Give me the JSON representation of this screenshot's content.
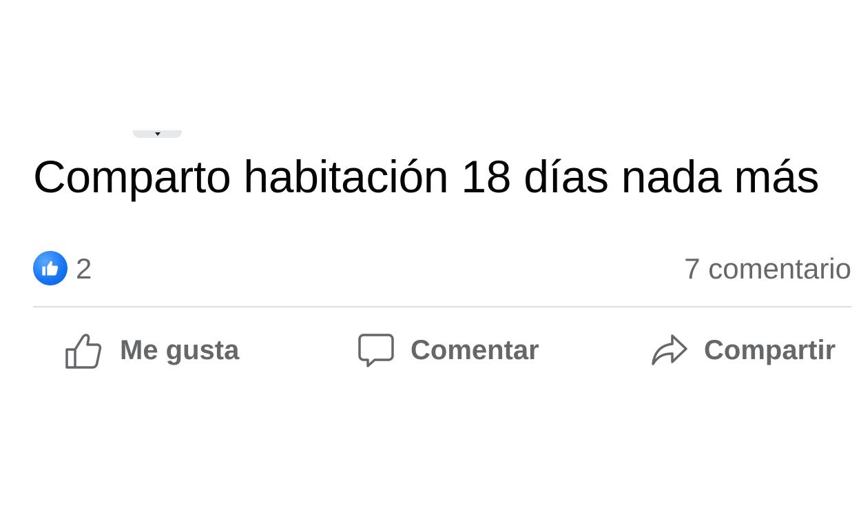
{
  "post": {
    "text": "Comparto habitación 18 días nada más"
  },
  "stats": {
    "reaction_icon": "like-reaction-icon",
    "reaction_count": "2",
    "comment_count": "7 comentario"
  },
  "actions": {
    "like_label": "Me gusta",
    "comment_label": "Comentar",
    "share_label": "Compartir"
  },
  "colors": {
    "brand_blue": "#1877f2",
    "secondary_text": "#65676b",
    "primary_text": "#050505",
    "divider": "#dadde1"
  }
}
